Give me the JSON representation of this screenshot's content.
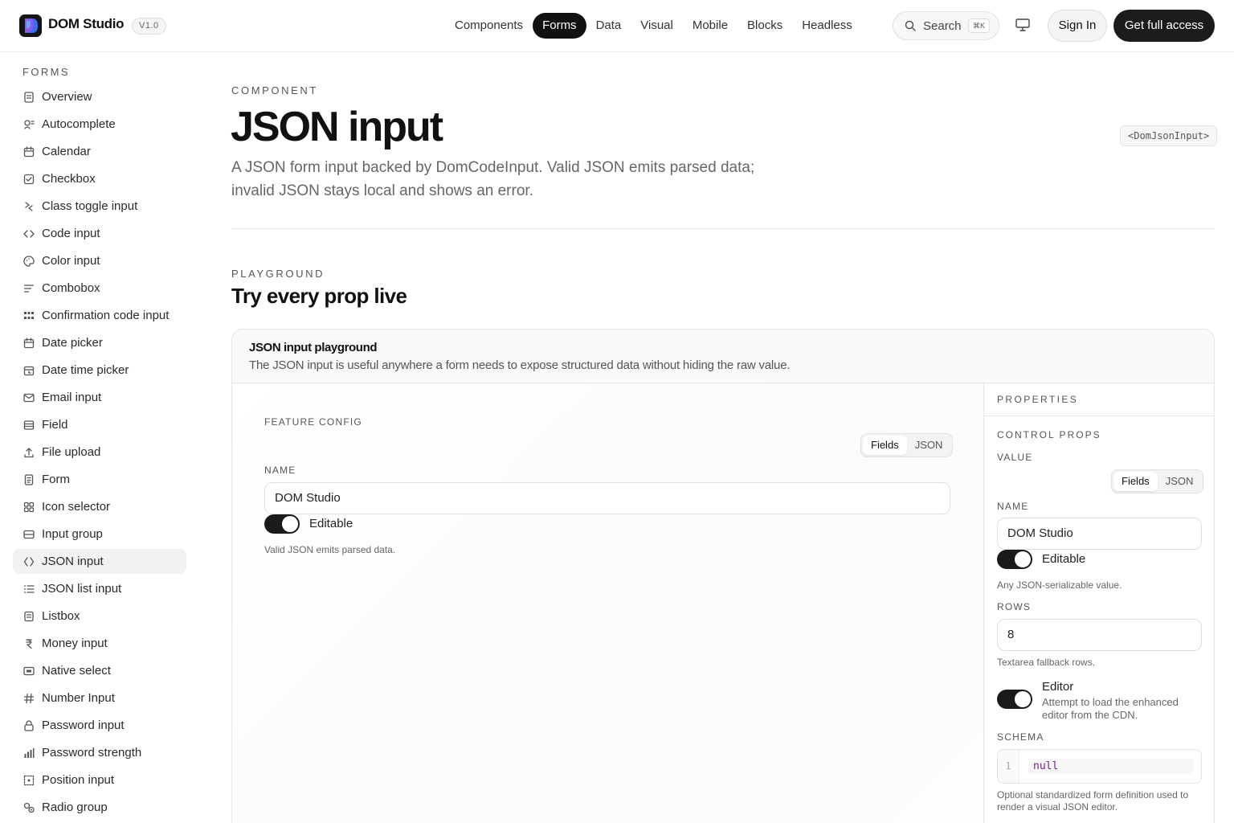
{
  "header": {
    "brand": "DOM Studio",
    "version": "V1.0",
    "nav": [
      "Components",
      "Forms",
      "Data",
      "Visual",
      "Mobile",
      "Blocks",
      "Headless"
    ],
    "active_nav": "Forms",
    "search_label": "Search",
    "search_shortcut": "⌘K",
    "signin_label": "Sign In",
    "cta_label": "Get full access"
  },
  "sidebar": {
    "heading": "FORMS",
    "active": "JSON input",
    "items": [
      {
        "label": "Overview",
        "icon": "doc-icon"
      },
      {
        "label": "Autocomplete",
        "icon": "autocomplete-icon"
      },
      {
        "label": "Calendar",
        "icon": "calendar-icon"
      },
      {
        "label": "Checkbox",
        "icon": "checkbox-icon"
      },
      {
        "label": "Class toggle input",
        "icon": "class-toggle-icon"
      },
      {
        "label": "Code input",
        "icon": "code-icon"
      },
      {
        "label": "Color input",
        "icon": "palette-icon"
      },
      {
        "label": "Combobox",
        "icon": "combobox-icon"
      },
      {
        "label": "Confirmation code input",
        "icon": "grid-icon"
      },
      {
        "label": "Date picker",
        "icon": "calendar-icon"
      },
      {
        "label": "Date time picker",
        "icon": "calendar-clock-icon"
      },
      {
        "label": "Email input",
        "icon": "mail-icon"
      },
      {
        "label": "Field",
        "icon": "field-icon"
      },
      {
        "label": "File upload",
        "icon": "upload-icon"
      },
      {
        "label": "Form",
        "icon": "form-icon"
      },
      {
        "label": "Icon selector",
        "icon": "icon-grid-icon"
      },
      {
        "label": "Input group",
        "icon": "input-group-icon"
      },
      {
        "label": "JSON input",
        "icon": "json-icon"
      },
      {
        "label": "JSON list input",
        "icon": "list-icon"
      },
      {
        "label": "Listbox",
        "icon": "listbox-icon"
      },
      {
        "label": "Money input",
        "icon": "money-icon"
      },
      {
        "label": "Native select",
        "icon": "select-icon"
      },
      {
        "label": "Number Input",
        "icon": "hash-icon"
      },
      {
        "label": "Password input",
        "icon": "lock-icon"
      },
      {
        "label": "Password strength",
        "icon": "bars-icon"
      },
      {
        "label": "Position input",
        "icon": "position-icon"
      },
      {
        "label": "Radio group",
        "icon": "radio-icon"
      }
    ]
  },
  "page": {
    "eyebrow": "COMPONENT",
    "title": "JSON input",
    "tag": "<DomJsonInput>",
    "description": "A JSON form input backed by DomCodeInput. Valid JSON emits parsed data; invalid JSON stays local and shows an error."
  },
  "playground": {
    "eyebrow": "PLAYGROUND",
    "title": "Try every prop live",
    "card_title": "JSON input playground",
    "card_subtitle": "The JSON input is useful anywhere a form needs to expose structured data without hiding the raw value.",
    "preview": {
      "section_label": "FEATURE CONFIG",
      "mode_options": [
        "Fields",
        "JSON"
      ],
      "mode_selected": "Fields",
      "name_label": "NAME",
      "name_value": "DOM Studio",
      "toggle_label": "Editable",
      "toggle_on": true,
      "hint": "Valid JSON emits parsed data."
    },
    "properties": {
      "heading": "PROPERTIES",
      "group_label": "CONTROL PROPS",
      "value_label": "VALUE",
      "mode_options": [
        "Fields",
        "JSON"
      ],
      "mode_selected": "Fields",
      "name_label": "NAME",
      "name_value": "DOM Studio",
      "editable_label": "Editable",
      "editable_on": true,
      "value_hint": "Any JSON-serializable value.",
      "rows_label": "ROWS",
      "rows_value": "8",
      "rows_hint": "Textarea fallback rows.",
      "editor_label": "Editor",
      "editor_desc": "Attempt to load the enhanced editor from the CDN.",
      "editor_on": true,
      "schema_label": "SCHEMA",
      "schema_line_number": "1",
      "schema_value": "null",
      "schema_hint": "Optional standardized form definition used to render a visual JSON editor."
    }
  },
  "colors": {
    "accent": "#111111",
    "muted_text": "#666666",
    "border": "#e6e6e6",
    "code_keyword": "#7a1f8c"
  }
}
